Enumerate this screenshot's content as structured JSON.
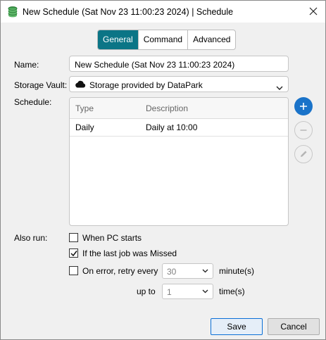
{
  "window": {
    "title": "New Schedule (Sat Nov 23 11:00:23 2024) | Schedule"
  },
  "tabs": [
    {
      "label": "General",
      "active": true
    },
    {
      "label": "Command",
      "active": false
    },
    {
      "label": "Advanced",
      "active": false
    }
  ],
  "form": {
    "name_label": "Name:",
    "name_value": "New Schedule (Sat Nov 23 11:00:23 2024)",
    "vault_label": "Storage Vault:",
    "vault_value": "Storage provided by DataPark",
    "schedule_label": "Schedule:"
  },
  "schedule_table": {
    "columns": [
      "Type",
      "Description"
    ],
    "rows": [
      {
        "type": "Daily",
        "description": "Daily at 10:00"
      }
    ]
  },
  "also_run": {
    "label": "Also run:",
    "when_pc_starts": {
      "label": "When PC starts",
      "checked": false
    },
    "last_job_missed": {
      "label": "If the last job was Missed",
      "checked": true
    },
    "retry_on_error": {
      "label": "On error, retry every",
      "checked": false
    },
    "retry_interval": "30",
    "retry_interval_unit": "minute(s)",
    "up_to_label": "up to",
    "retry_times": "1",
    "retry_times_unit": "time(s)"
  },
  "buttons": {
    "save": "Save",
    "cancel": "Cancel"
  },
  "colors": {
    "accent": "#0b7586",
    "add_button": "#1a73c9"
  }
}
